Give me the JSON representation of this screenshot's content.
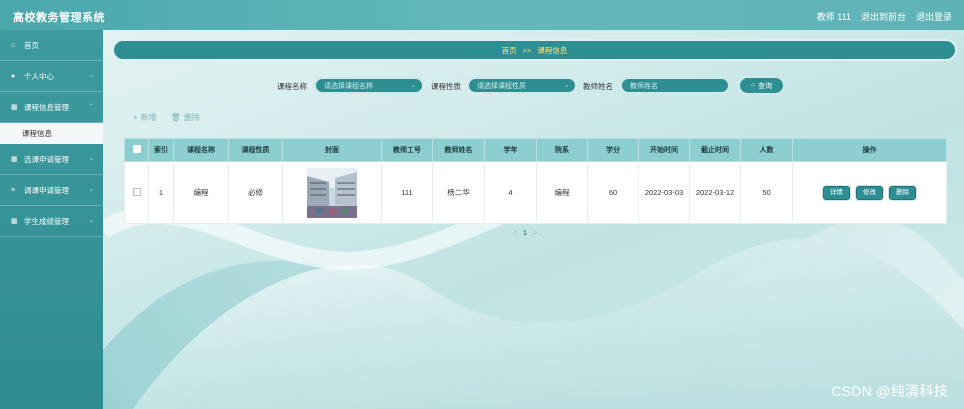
{
  "app": {
    "title": "高校教务管理系统"
  },
  "user": {
    "name": "教师 111",
    "to_desk": "退出到前台",
    "logout": "退出登录"
  },
  "sidebar": {
    "items": [
      {
        "label": "首页",
        "icon": "home-icon"
      },
      {
        "label": "个人中心",
        "icon": "user-icon"
      },
      {
        "label": "课程信息管理",
        "icon": "grid-icon"
      },
      {
        "label": "选课申请管理",
        "icon": "grid-icon"
      },
      {
        "label": "调课申请管理",
        "icon": "list-icon"
      },
      {
        "label": "学生成绩管理",
        "icon": "grid-icon"
      }
    ],
    "sub_item": {
      "label": "课程信息"
    }
  },
  "breadcrumb": {
    "home": "首页",
    "sep": ">>",
    "current": "课程信息"
  },
  "search": {
    "course_name": {
      "label": "课程名称",
      "placeholder": "请选择课程名称"
    },
    "course_type": {
      "label": "课程性质",
      "placeholder": "请选择课程性质"
    },
    "teacher_name": {
      "label": "教师姓名",
      "placeholder": "教师姓名"
    },
    "query_label": "查询"
  },
  "actions": {
    "add": "新增",
    "delete": "删除"
  },
  "table": {
    "columns": [
      "索引",
      "课程名称",
      "课程性质",
      "封面",
      "教师工号",
      "教师姓名",
      "学年",
      "院系",
      "学分",
      "开始时间",
      "截止时间",
      "人数",
      "操作"
    ],
    "rows": [
      {
        "index": "1",
        "course_name": "编程",
        "course_type": "必修",
        "teacher_no": "111",
        "teacher_name": "杨二华",
        "year": "4",
        "department": "编程",
        "credit": "60",
        "start": "2022-03-03",
        "end": "2022-03-12",
        "count": "50",
        "ops": [
          "详情",
          "修改",
          "删除"
        ]
      }
    ]
  },
  "pagination": {
    "prev": "<",
    "page": "1",
    "next": ">"
  },
  "watermark": "CSDN @纯清科技",
  "colors": {
    "primary": "#2e8f93",
    "header": "#8ccdd0",
    "crumb_text": "#ffe47a"
  }
}
